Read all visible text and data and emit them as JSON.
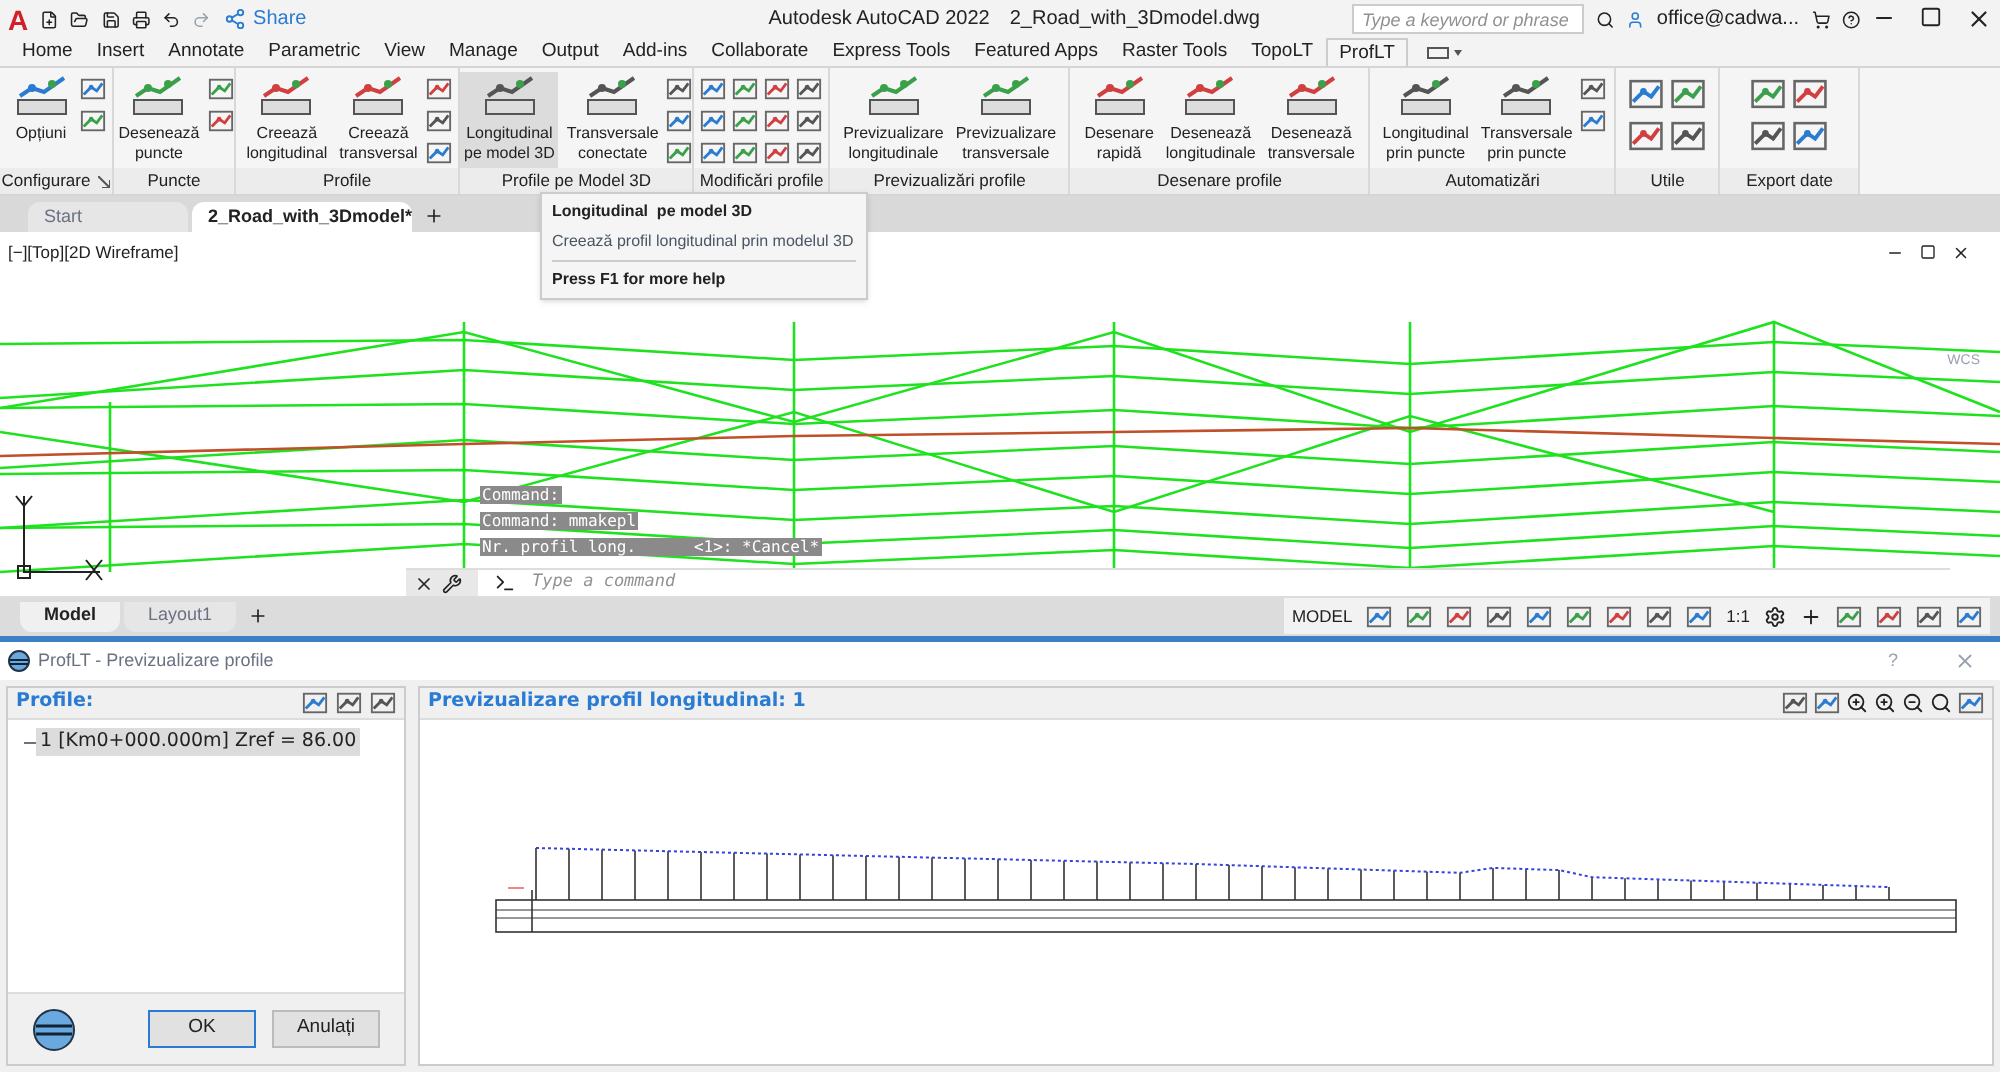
{
  "app": {
    "logo": "A",
    "title": "Autodesk AutoCAD 2022",
    "file": "2_Road_with_3Dmodel.dwg",
    "share": "Share",
    "search_placeholder": "Type a keyword or phrase",
    "user": "office@cadwa..."
  },
  "menu_tabs": [
    {
      "label": "Home",
      "selected": false
    },
    {
      "label": "Insert",
      "selected": false
    },
    {
      "label": "Annotate",
      "selected": false
    },
    {
      "label": "Parametric",
      "selected": false
    },
    {
      "label": "View",
      "selected": false
    },
    {
      "label": "Manage",
      "selected": false
    },
    {
      "label": "Output",
      "selected": false
    },
    {
      "label": "Add-ins",
      "selected": false
    },
    {
      "label": "Collaborate",
      "selected": false
    },
    {
      "label": "Express Tools",
      "selected": false
    },
    {
      "label": "Featured Apps",
      "selected": false
    },
    {
      "label": "Raster Tools",
      "selected": false
    },
    {
      "label": "TopoLT",
      "selected": false
    },
    {
      "label": "ProfLT",
      "selected": true
    }
  ],
  "ribbon_groups": [
    {
      "label": "Configurare",
      "launcher": true,
      "buttons": [
        {
          "label": "Opțiuni",
          "highlighted": false
        }
      ]
    },
    {
      "label": "Puncte",
      "buttons": [
        {
          "label": "Desenează\npuncte",
          "highlighted": false
        }
      ]
    },
    {
      "label": "Profile",
      "buttons": [
        {
          "label": "Creează\nlongitudinal",
          "highlighted": false
        },
        {
          "label": "Creează\ntransversal",
          "highlighted": false
        }
      ]
    },
    {
      "label": "Profile pe Model 3D",
      "buttons": [
        {
          "label": "Longitudinal\npe model 3D",
          "highlighted": true
        },
        {
          "label": "Transversale\nconectate",
          "highlighted": false
        }
      ]
    },
    {
      "label": "Modificări profile"
    },
    {
      "label": "Previzualizări profile",
      "buttons": [
        {
          "label": "Previzualizare\nlongitudinale",
          "highlighted": false
        },
        {
          "label": "Previzualizare\ntransversale",
          "highlighted": false
        }
      ]
    },
    {
      "label": "Desenare profile",
      "buttons": [
        {
          "label": "Desenare\nrapidă",
          "highlighted": false
        },
        {
          "label": "Desenează\nlongitudinale",
          "highlighted": false
        },
        {
          "label": "Desenează\ntransversale",
          "highlighted": false
        }
      ]
    },
    {
      "label": "Automatizări",
      "buttons": [
        {
          "label": "Longitudinal\nprin puncte",
          "highlighted": false
        },
        {
          "label": "Transversale\nprin puncte",
          "highlighted": false
        }
      ]
    },
    {
      "label": "Utile"
    },
    {
      "label": "Export date"
    }
  ],
  "document_tabs": [
    {
      "label": "Start",
      "selected": false
    },
    {
      "label": "2_Road_with_3Dmodel*",
      "selected": true
    }
  ],
  "viewport": {
    "label": "[−][Top][2D Wireframe]",
    "viewcube_label": "WCS",
    "command_history": [
      "Command:",
      "Command: mmakepl",
      "Nr. profil long.      <1>: *Cancel*"
    ],
    "command_placeholder": "Type a command"
  },
  "layout_tabs": [
    {
      "label": "Model",
      "selected": true
    },
    {
      "label": "Layout1",
      "selected": false
    }
  ],
  "status_bar": {
    "mode": "MODEL",
    "scale": "1:1"
  },
  "tooltip": {
    "title": "Longitudinal  pe model 3D",
    "description": "Creează profil longitudinal prin modelul 3D",
    "help": "Press F1 for more help"
  },
  "dialog": {
    "title": "ProfLT - Previzualizare profile",
    "help": "?",
    "profiles_heading": "Profile:",
    "profiles": [
      {
        "label": "1 [Km0+000.000m] Zref = 86.00",
        "selected": true
      }
    ],
    "preview_heading": "Previzualizare profil longitudinal: 1",
    "buttons": [
      {
        "label": "OK",
        "default": true
      },
      {
        "label": "Anulați",
        "default": false
      }
    ]
  }
}
